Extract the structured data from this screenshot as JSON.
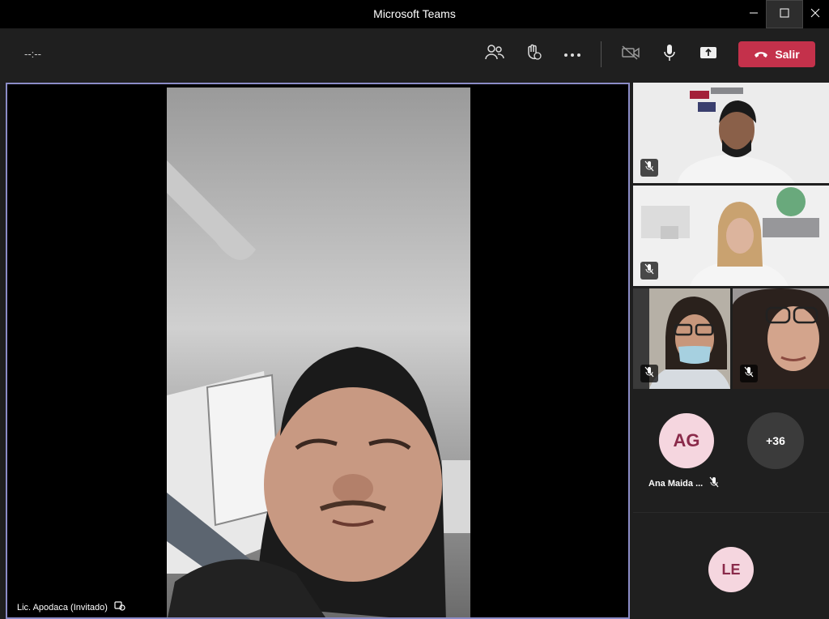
{
  "window": {
    "title": "Microsoft Teams"
  },
  "toolbar": {
    "timer": "--:--",
    "leave_label": "Salir",
    "icons": [
      "participants-icon",
      "raise-hand-icon",
      "more-options-icon",
      "camera-off-icon",
      "microphone-icon",
      "share-screen-icon"
    ]
  },
  "main_video": {
    "label": "Lic. Apodaca (Invitado)"
  },
  "participants": [
    {
      "initials": "AG",
      "name": "Ana Maida ..."
    },
    {
      "initials": "+36"
    },
    {
      "initials": "LE"
    }
  ],
  "colors": {
    "accent": "#8b8cc7",
    "leave": "#c4314b",
    "avatar_bg": "#f5d6df",
    "avatar_fg": "#8a2a4a"
  }
}
